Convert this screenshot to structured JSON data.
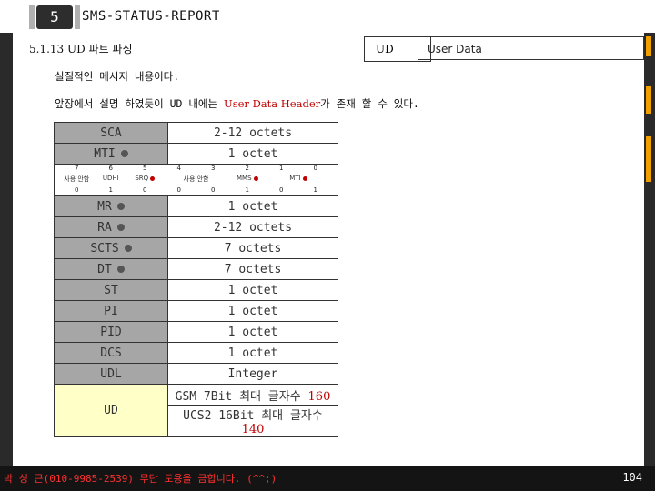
{
  "header": {
    "chapter_number": "5",
    "title": "SMS-STATUS-REPORT"
  },
  "section": {
    "title": "5.1.13 UD 파트 파싱",
    "ud_label": "UD",
    "ud_value": "User Data"
  },
  "body": {
    "line1": "실질적인 메시지 내용이다.",
    "line2_prefix": "앞장에서 설명 하였듯이 UD 내에는 ",
    "line2_highlight": "User Data Header",
    "line2_suffix": "가 존재 할 수 있다."
  },
  "table": {
    "rows": [
      {
        "key": "SCA",
        "value": "2-12 octets",
        "dot": false
      },
      {
        "key": "MTI",
        "value": "1 octet",
        "dot": true
      },
      {
        "key": "MR",
        "value": "1 octet",
        "dot": true
      },
      {
        "key": "RA",
        "value": "2-12 octets",
        "dot": true
      },
      {
        "key": "SCTS",
        "value": "7 octets",
        "dot": true
      },
      {
        "key": "DT",
        "value": "7 octets",
        "dot": true
      },
      {
        "key": "ST",
        "value": "1 octet",
        "dot": false
      },
      {
        "key": "PI",
        "value": "1 octet",
        "dot": false
      },
      {
        "key": "PID",
        "value": "1 octet",
        "dot": false
      },
      {
        "key": "DCS",
        "value": "1 octet",
        "dot": false
      },
      {
        "key": "UDL",
        "value": "Integer",
        "dot": false
      }
    ],
    "bit_numbers": [
      "7",
      "6",
      "5",
      "4",
      "3",
      "2",
      "1",
      "0"
    ],
    "bit_labels": [
      "사용 안함",
      "UDHI",
      "SRQ",
      "사용 안함",
      "MMS",
      "MTI"
    ],
    "bit_values": [
      "0",
      "1",
      "0",
      "0",
      "0",
      "1",
      "0",
      "1"
    ],
    "ud_key": "UD",
    "ud_line1_prefix": "GSM 7Bit 최대 글자수 ",
    "ud_line1_num": "160",
    "ud_line2_prefix": "UCS2 16Bit 최대 글자수 ",
    "ud_line2_num": "140"
  },
  "footer": {
    "text": "박 성 근(010-9985-2539) 무단 도용을 금합니다. (^^;)",
    "page_number": "104"
  },
  "colors": {
    "key_cell": "#a6a6a6",
    "ud_cell": "#ffffc8",
    "highlight": "#c00000",
    "accent_tab": "#f0a000"
  }
}
